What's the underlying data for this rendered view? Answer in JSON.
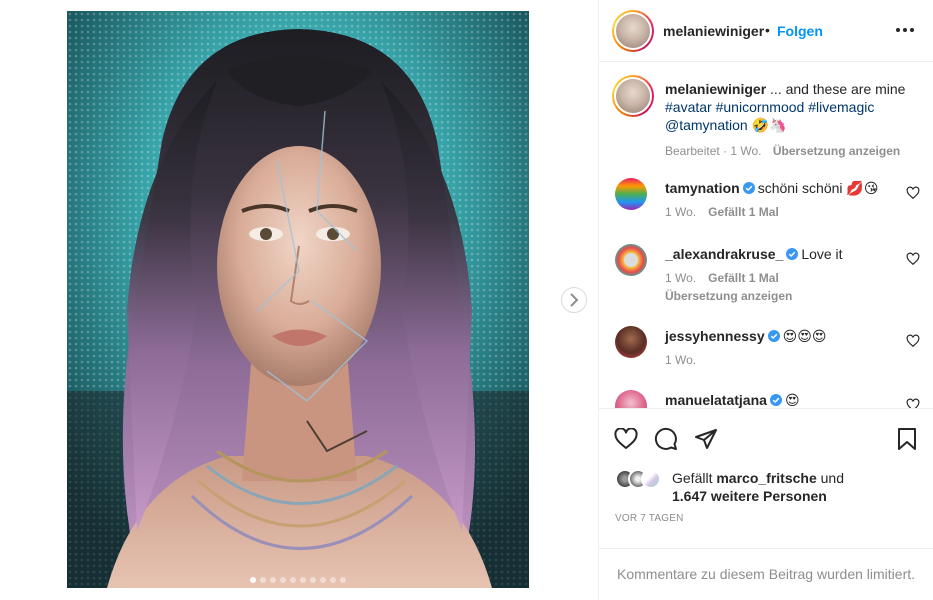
{
  "post": {
    "image_alt": "Portrait of a woman with long lilac-ombré hair, glowing geometric lines on her face and layered necklaces in front of a turquoise patterned background",
    "slide_count": 10,
    "active_slide": 1
  },
  "header": {
    "username": "melaniewiniger",
    "separator": "•",
    "follow_label": "Folgen",
    "more_icon": "more-horizontal-icon"
  },
  "caption": {
    "username": "melaniewiniger",
    "text_lead": "... and these are mine",
    "hashtags": [
      "#avatar",
      "#unicornmood",
      "#livemagic"
    ],
    "mention": "@tamynation",
    "emojis": "🤣🦄",
    "edited_label": "Bearbeitet",
    "time": "1 Wo.",
    "translate_label": "Übersetzung anzeigen"
  },
  "comments": [
    {
      "username": "tamynation",
      "verified": true,
      "text": "schöni schöni 💋😘",
      "time": "1 Wo.",
      "likes": "Gefällt 1 Mal",
      "translate": ""
    },
    {
      "username": "_alexandrakruse_",
      "verified": true,
      "text": "Love it",
      "time": "1 Wo.",
      "likes": "Gefällt 1 Mal",
      "translate": "Übersetzung anzeigen"
    },
    {
      "username": "jessyhennessy",
      "verified": true,
      "text": "😍😍😍",
      "time": "1 Wo.",
      "likes": "",
      "translate": ""
    },
    {
      "username": "manuelatatjana",
      "verified": true,
      "text": "😍",
      "time": "",
      "likes": "",
      "translate": ""
    }
  ],
  "likes": {
    "prefix": "Gefällt",
    "user": "marco_fritsche",
    "joiner": "und",
    "others": "1.647 weitere Personen"
  },
  "posted_ago": "VOR 7 TAGEN",
  "footer_text": "Kommentare zu diesem Beitrag wurden limitiert.",
  "colors": {
    "link_blue": "#0095f6",
    "hashtag_blue": "#00376b",
    "verified_blue": "#3897f0",
    "muted": "#8e8e8e",
    "text": "#262626"
  }
}
